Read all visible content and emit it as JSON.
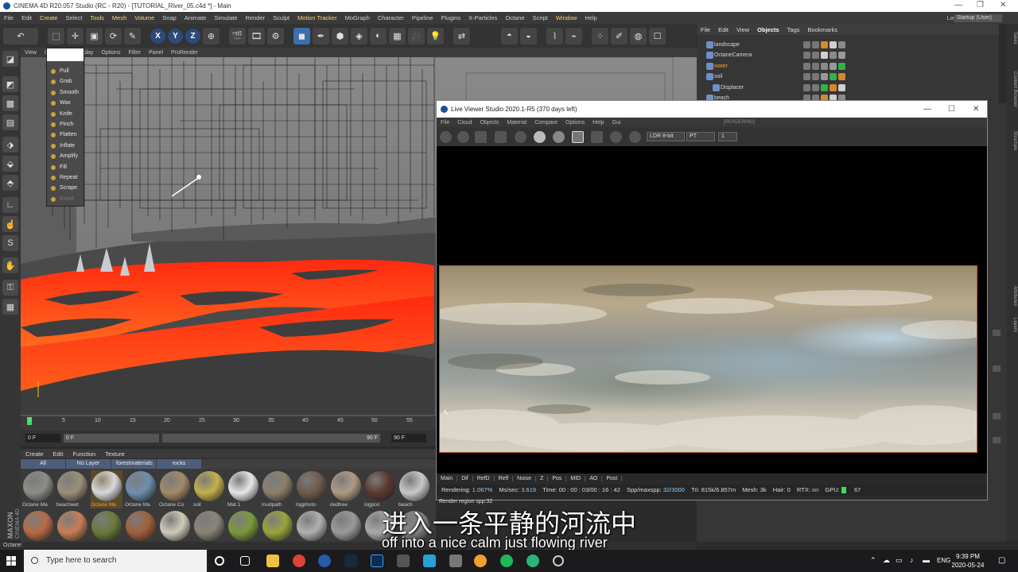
{
  "app": {
    "title": "CINEMA 4D R20.057 Studio (RC - R20) - [TUTORIAL_River_05.c4d *] - Main",
    "menu": [
      "File",
      "Edit",
      "Create",
      "Select",
      "Tools",
      "Mesh",
      "Volume",
      "Snap",
      "Animate",
      "Simulate",
      "Render",
      "Sculpt",
      "Motion Tracker",
      "MoGraph",
      "Character",
      "Pipeline",
      "Plugins",
      "X-Particles",
      "Octane",
      "Script",
      "Window",
      "Help"
    ],
    "layout_label": "Layout:",
    "layout_value": "Startup (User)"
  },
  "viewport": {
    "menu": [
      "View",
      "Cameras",
      "Display",
      "Options",
      "Filter",
      "Panel",
      "ProRender"
    ],
    "sculpt_tools": [
      "Pull",
      "Grab",
      "Smooth",
      "Wax",
      "Knife",
      "Pinch",
      "Flatten",
      "Inflate",
      "Amplify",
      "Fill",
      "Repeat",
      "Scrape",
      "Erase"
    ]
  },
  "timeline": {
    "ticks": [
      "0",
      "5",
      "10",
      "15",
      "20",
      "25",
      "30",
      "35",
      "40",
      "45",
      "50",
      "55"
    ],
    "start_field": "0 F",
    "current_field": "0 F",
    "end_field": "90 F",
    "end_field2": "90 F"
  },
  "materials": {
    "menu": [
      "Create",
      "Edit",
      "Function",
      "Texture"
    ],
    "filters": [
      "All",
      "No Layer",
      "forestmaterials",
      "rocks"
    ],
    "row1": [
      {
        "label": "Octane Ma",
        "color": "#8a8e86",
        "selected": false
      },
      {
        "label": "beachwet",
        "color": "#9b8f7a",
        "selected": false
      },
      {
        "label": "Octane Ma",
        "color": "#d8d8d8",
        "selected": true
      },
      {
        "label": "Octane Ma",
        "color": "#6f8fb0",
        "selected": false
      },
      {
        "label": "Octane Co",
        "color": "#a48a6a",
        "selected": false
      },
      {
        "label": "soil",
        "color": "#c3b04a",
        "selected": false
      },
      {
        "label": "Mat.1",
        "color": "#e6e6e6",
        "selected": false
      },
      {
        "label": "mudpath",
        "color": "#8d7f6a",
        "selected": false
      },
      {
        "label": "logphoto",
        "color": "#6e5a4a",
        "selected": false
      },
      {
        "label": "dedtree",
        "color": "#b09a84",
        "selected": false
      },
      {
        "label": "logpoo",
        "color": "#5a3a30",
        "selected": false
      },
      {
        "label": "beach",
        "color": "#c8c8c8",
        "selected": false
      }
    ],
    "row2": [
      {
        "color": "#b86a45"
      },
      {
        "color": "#c97d55"
      },
      {
        "color": "#6a7a3a"
      },
      {
        "color": "#a0603c"
      },
      {
        "color": "#cfcabb"
      },
      {
        "color": "#8a8478"
      },
      {
        "color": "#7a9a3a"
      },
      {
        "color": "#9aa43a"
      },
      {
        "color": "#b0b0b0"
      },
      {
        "color": "#9a9a9a"
      },
      {
        "color": "#aaaaaa"
      },
      {
        "color": "#8a8a8a"
      }
    ]
  },
  "status": "Octane:",
  "objects": {
    "menu": [
      "File",
      "Edit",
      "View",
      "Objects",
      "Tags",
      "Bookmarks"
    ],
    "items": [
      {
        "name": "landscape",
        "highlight": false
      },
      {
        "name": "OctaneCamera",
        "highlight": false
      },
      {
        "name": "water",
        "highlight": true
      },
      {
        "name": "soil",
        "highlight": false
      },
      {
        "name": "Displacer",
        "highlight": false
      },
      {
        "name": "beach",
        "highlight": false
      }
    ]
  },
  "right_tabs": [
    "Takes",
    "Content Browser",
    "Structure",
    "Attributes",
    "Layers"
  ],
  "live_viewer": {
    "title": "Live Viewer Studio 2020.1-R5 (370 days left)",
    "menu": [
      "File",
      "Cloud",
      "Objects",
      "Material",
      "Compare",
      "Options",
      "Help",
      "Gui"
    ],
    "state": "[RENDERING]",
    "ldr": "LDR 8-bit",
    "mode": "PT",
    "count": "1",
    "render_region": "Render region spp:32",
    "tabs": [
      "Main",
      "Dif",
      "RefD",
      "Refl",
      "Noise",
      "Z",
      "Pos",
      "MID",
      "AO",
      "Post"
    ],
    "stats": {
      "rendering_k": "Rendering:",
      "rendering_v": "1.067%",
      "ms_k": "Ms/sec:",
      "ms_v": "3.619",
      "time_k": "Time:",
      "time_v": "00 : 00 : 03/00 : 16 : 42",
      "spp_k": "Spp/maxspp:",
      "spp_v": "32/3000",
      "tri_k": "Tri:",
      "tri_v": "815k/6.857m",
      "mesh_k": "Mesh:",
      "mesh_v": "3k",
      "hair_k": "Hair:",
      "hair_v": "0",
      "rtx_k": "RTX:",
      "rtx_v": "on",
      "gpu_k": "GPU:",
      "gpu_v": "67"
    }
  },
  "subtitles": {
    "cn": "进入一条平静的河流中",
    "en": "off into a nice calm just flowing river"
  },
  "taskbar": {
    "search_placeholder": "Type here to search",
    "lang": "ENG",
    "time": "9:39 PM",
    "date": "2020-05-24"
  },
  "colors": {
    "lava": "#ff3b14",
    "accent_orange": "#ff9a2a",
    "lv_stat_value": "#8fd0ff"
  }
}
